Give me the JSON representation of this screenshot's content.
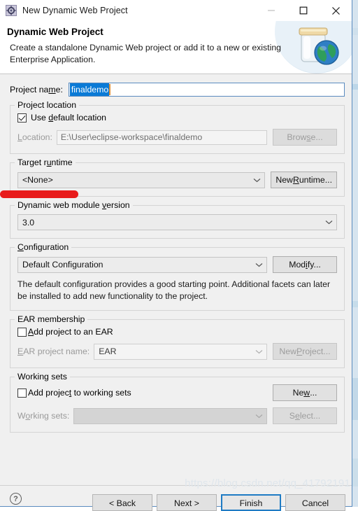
{
  "window": {
    "title": "New Dynamic Web Project",
    "icon": "gear-icon",
    "minimize_label": "—",
    "maximize_label": "□",
    "close_label": "✕"
  },
  "header": {
    "title": "Dynamic Web Project",
    "description": "Create a standalone Dynamic Web project or add it to a new or existing Enterprise Application.",
    "icon": "jar-globe-icon"
  },
  "project_name": {
    "label": "Project name:",
    "value": "finaldemo",
    "selected": true
  },
  "project_location": {
    "group_title": "Project location",
    "use_default_label": "Use default location",
    "use_default_checked": true,
    "location_label": "Location:",
    "location_value": "E:\\User\\eclipse-workspace\\finaldemo",
    "browse_label": "Browse...",
    "browse_enabled": false
  },
  "target_runtime": {
    "group_title": "Target runtime",
    "value": "<None>",
    "new_runtime_label": "New Runtime...",
    "new_runtime_enabled": true
  },
  "module_version": {
    "group_title": "Dynamic web module version",
    "value": "3.0"
  },
  "configuration": {
    "group_title": "Configuration",
    "value": "Default Configuration",
    "modify_label": "Modify...",
    "help_text": "The default configuration provides a good starting point. Additional facets can later be installed to add new functionality to the project."
  },
  "ear_membership": {
    "group_title": "EAR membership",
    "add_to_ear_label": "Add project to an EAR",
    "add_to_ear_checked": false,
    "ear_project_name_label": "EAR project name:",
    "ear_project_name_value": "EAR",
    "new_project_label": "New Project...",
    "new_project_enabled": false
  },
  "working_sets": {
    "group_title": "Working sets",
    "add_to_working_sets_label": "Add project to working sets",
    "add_to_working_sets_checked": false,
    "new_label": "New...",
    "working_sets_label": "Working sets:",
    "working_sets_value": "",
    "select_label": "Select...",
    "select_enabled": false
  },
  "footer": {
    "help_label": "?",
    "back_label": "< Back",
    "next_label": "Next >",
    "finish_label": "Finish",
    "cancel_label": "Cancel"
  },
  "watermark": {
    "text": "https://blog.csdn.net/qq_41792191"
  },
  "annotation": {
    "color": "#e81b1b",
    "target": "target-runtime-combo"
  }
}
